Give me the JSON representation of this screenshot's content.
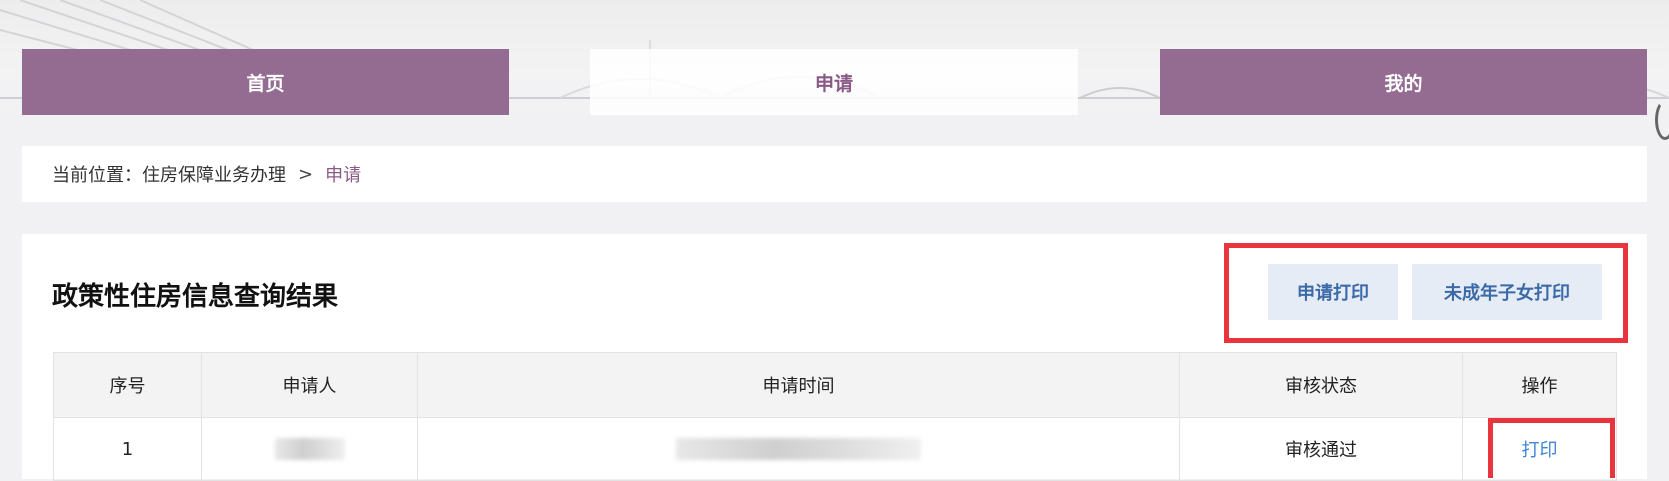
{
  "nav": {
    "tabs": [
      {
        "label": "首页"
      },
      {
        "label": "申请"
      },
      {
        "label": "我的"
      }
    ]
  },
  "breadcrumb": {
    "prefix": "当前位置：住房保障业务办理",
    "separator": ">",
    "current": "申请"
  },
  "panel": {
    "title": "政策性住房信息查询结果",
    "buttons": {
      "print_apply": "申请打印",
      "print_minor": "未成年子女打印"
    }
  },
  "table": {
    "headers": [
      "序号",
      "申请人",
      "申请时间",
      "审核状态",
      "操作"
    ],
    "rows": [
      {
        "index": "1",
        "status": "审核通过",
        "action": "打印"
      }
    ]
  },
  "colors": {
    "nav_purple": "#946c91",
    "accent_purple_text": "#8a5a86",
    "highlight_red": "#e8343c",
    "link_blue": "#3f86d6",
    "button_bg": "#e6ecf5",
    "button_text": "#3c6aa8"
  }
}
